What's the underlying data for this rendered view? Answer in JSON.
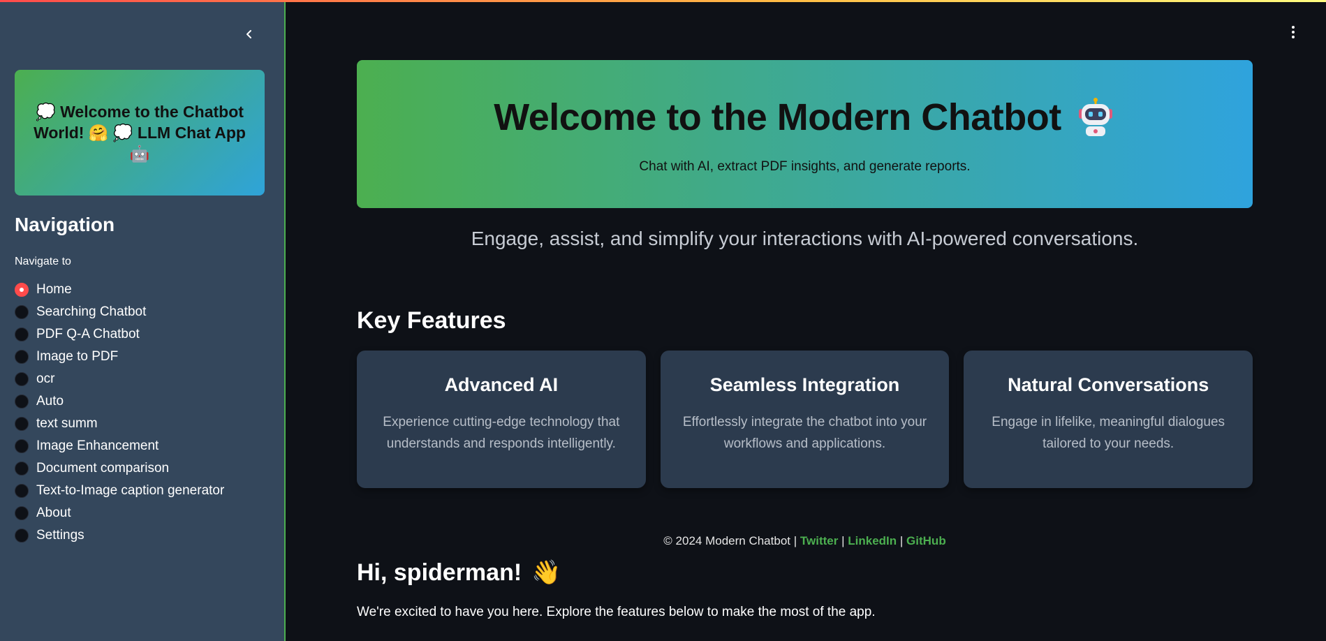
{
  "colors": {
    "sidebar_bg": "#34475c",
    "main_bg": "#0e1117",
    "accent_green": "#4caf50",
    "accent_blue": "#2fa3dd",
    "radio_selected": "#ff4b4b",
    "card_bg": "#2c3b4e"
  },
  "sidebar": {
    "collapse_icon": "chevron-left-icon",
    "welcome_text": "💭 Welcome to the Chatbot World! 🤗 💭 LLM Chat App 🤖",
    "nav_title": "Navigation",
    "nav_label": "Navigate to",
    "selected": "Home",
    "items": [
      {
        "label": "Home",
        "checked": true
      },
      {
        "label": "Searching Chatbot",
        "checked": false
      },
      {
        "label": "PDF Q-A Chatbot",
        "checked": false
      },
      {
        "label": "Image to PDF",
        "checked": false
      },
      {
        "label": "ocr",
        "checked": false
      },
      {
        "label": "Auto",
        "checked": false
      },
      {
        "label": "text summ",
        "checked": false
      },
      {
        "label": "Image Enhancement",
        "checked": false
      },
      {
        "label": "Document comparison",
        "checked": false
      },
      {
        "label": "Text-to-Image caption generator",
        "checked": false
      },
      {
        "label": "About",
        "checked": false
      },
      {
        "label": "Settings",
        "checked": false
      }
    ]
  },
  "main": {
    "menu_icon": "kebab-menu-icon",
    "hero": {
      "title": "Welcome to the Modern Chatbot",
      "title_icon": "robot-icon",
      "subtitle": "Chat with AI, extract PDF insights, and generate reports."
    },
    "tagline": "Engage, assist, and simplify your interactions with AI-powered conversations.",
    "features_title": "Key Features",
    "features": [
      {
        "title": "Advanced AI",
        "text": "Experience cutting-edge technology that understands and responds intelligently."
      },
      {
        "title": "Seamless Integration",
        "text": "Effortlessly integrate the chatbot into your workflows and applications."
      },
      {
        "title": "Natural Conversations",
        "text": "Engage in lifelike, meaningful dialogues tailored to your needs."
      }
    ],
    "footer": {
      "copyright": "© 2024 Modern Chatbot",
      "separator": "|",
      "links": [
        "Twitter",
        "LinkedIn",
        "GitHub"
      ]
    },
    "greeting": {
      "title": "Hi, spiderman!",
      "emoji": "👋",
      "text": "We're excited to have you here. Explore the features below to make the most of the app."
    }
  }
}
